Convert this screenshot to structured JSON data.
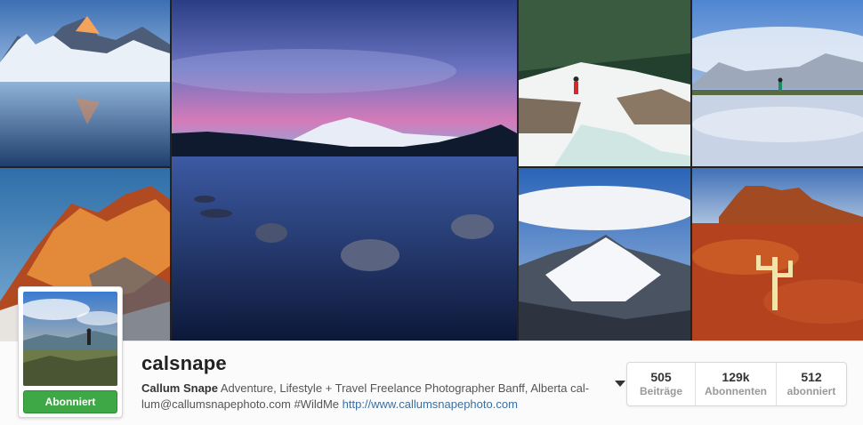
{
  "profile": {
    "username": "calsnape",
    "full_name": "Callum Snape",
    "bio_text": "Adventure, Lifestyle + Travel Freelance Photographer Banff, Alberta cal-lum@callumsnapephoto.com #WildMe",
    "website": "http://www.callumsnapephoto.com",
    "follow_button_label": "Abonniert"
  },
  "stats": [
    {
      "value": "505",
      "label": "Beiträge"
    },
    {
      "value": "129k",
      "label": "Abonnenten"
    },
    {
      "value": "512",
      "label": "abonniert"
    }
  ],
  "colors": {
    "follow_button": "#3fa846",
    "link": "#3b6fa0"
  }
}
